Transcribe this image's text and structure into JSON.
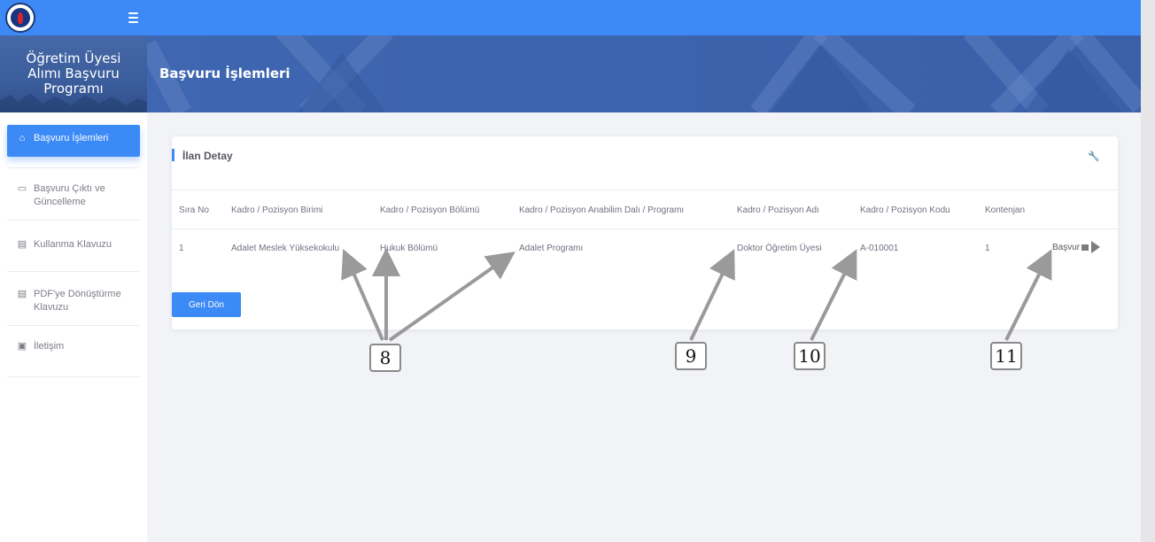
{
  "app": {
    "title_lines": [
      "Öğretim Üyesi",
      "Alımı Başvuru",
      "Programı"
    ],
    "menu_icon": "hamburger-icon",
    "logo_icon": "university-logo-icon"
  },
  "sidebar": {
    "items": [
      {
        "label": "Başvuru İşlemleri",
        "icon": "home-icon",
        "active": true
      },
      {
        "label": "Başvuru Çıktı ve Güncelleme",
        "icon": "print-icon",
        "active": false
      },
      {
        "label": "Kullanma Klavuzu",
        "icon": "book-icon",
        "active": false
      },
      {
        "label": "PDF'ye Dönüştürme Klavuzu",
        "icon": "book-icon",
        "active": false
      },
      {
        "label": "İletişim",
        "icon": "contact-card-icon",
        "active": false
      }
    ]
  },
  "header": {
    "title": "Başvuru İşlemleri"
  },
  "card": {
    "title": "İlan Detay",
    "tool_icon": "wrench-icon",
    "columns": [
      "Sıra No",
      "Kadro / Pozisyon Birimi",
      "Kadro / Pozisyon Bölümü",
      "Kadro / Pozisyon Anabilim Dalı / Programı",
      "Kadro / Pozisyon Adı",
      "Kadro / Pozisyon Kodu",
      "Kontenjan"
    ],
    "rows": [
      {
        "cells": [
          "1",
          "Adalet Meslek Yüksekokulu",
          "Hukuk Bölümü",
          "Adalet Programı",
          "Doktor Öğretim Üyesi",
          "A-010001",
          "1"
        ],
        "action_label": "Başvur",
        "action_icon": "arrow-right-icon"
      }
    ],
    "back_label": "Geri Dön"
  },
  "annotations": [
    "8",
    "9",
    "10",
    "11"
  ],
  "colors": {
    "primary": "#3b8af5",
    "topbar": "#3d8af7",
    "hero": "#3d64ae",
    "annotation_arrow": "#9a9a9a"
  }
}
